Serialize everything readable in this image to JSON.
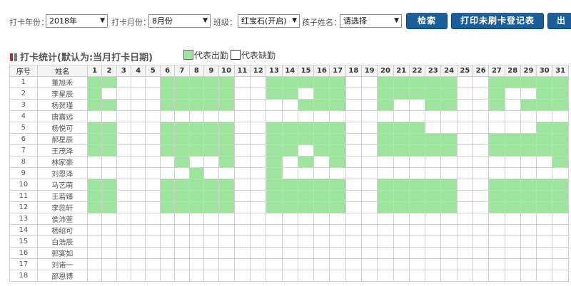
{
  "filters": {
    "year_label": "打卡年份：",
    "year_value": "2018年",
    "month_label": "打卡月份：",
    "month_value": "8月份",
    "class_label": "班级：",
    "class_value": "红宝石(开启)",
    "child_label": "孩子姓名：",
    "child_value": "请选择",
    "search_button": "检索",
    "print_button": "打印未刷卡登记表",
    "export_button": "出"
  },
  "section": {
    "title": "打卡统计(默认为:当月打卡日期)",
    "legend_present": "代表出勤",
    "legend_absent": "代表缺勤"
  },
  "colors": {
    "present": "#9ee39e",
    "absent": "#ffffff",
    "button": "#1a5f9a"
  },
  "table": {
    "header_no": "序号",
    "header_name": "姓名",
    "days": [
      "1",
      "2",
      "3",
      "4",
      "5",
      "6",
      "7",
      "8",
      "9",
      "10",
      "11",
      "12",
      "13",
      "14",
      "15",
      "16",
      "17",
      "18",
      "19",
      "20",
      "21",
      "22",
      "23",
      "24",
      "25",
      "26",
      "27",
      "28",
      "29",
      "30",
      "31"
    ],
    "rows": [
      {
        "no": "1",
        "name": "董旭禾",
        "att": "1100011111001111100111110011111"
      },
      {
        "no": "2",
        "name": "李星辰",
        "att": "1000011111001101100111110010011"
      },
      {
        "no": "3",
        "name": "杨贺瑾",
        "att": "1100011111000011100100110010111"
      },
      {
        "no": "4",
        "name": "唐嘉远",
        "att": "0000000000000000000000000000000"
      },
      {
        "no": "5",
        "name": "杨悦可",
        "att": "1100011111001111100111000000011"
      },
      {
        "no": "6",
        "name": "郝星辰",
        "att": "1100011111001111100111110011111"
      },
      {
        "no": "7",
        "name": "王茂泽",
        "att": "1100011111001101100111110011111"
      },
      {
        "no": "8",
        "name": "林家豪",
        "att": "0000001001001010100000000000001"
      },
      {
        "no": "9",
        "name": "刘恩泽",
        "att": "0000000100001000000000000000000"
      },
      {
        "no": "10",
        "name": "马艺萌",
        "att": "1100011111001111100111110011111"
      },
      {
        "no": "11",
        "name": "王若臻",
        "att": "1100011111001111100111110011111"
      },
      {
        "no": "12",
        "name": "李蕊轩",
        "att": "1100011111001111100111110011111"
      },
      {
        "no": "13",
        "name": "侯沛萱",
        "att": "0000000000000000000000000000000"
      },
      {
        "no": "14",
        "name": "杨绍可",
        "att": "0000000000000000000000000000000"
      },
      {
        "no": "15",
        "name": "白浩辰",
        "att": "0000000000000000000000000000000"
      },
      {
        "no": "16",
        "name": "郭宴如",
        "att": "0000000000000000000000000000000"
      },
      {
        "no": "17",
        "name": "刘诺一",
        "att": "0000000000000000000000000000000"
      },
      {
        "no": "18",
        "name": "邵恩博",
        "att": "0000000000000000000000000000000"
      }
    ]
  }
}
